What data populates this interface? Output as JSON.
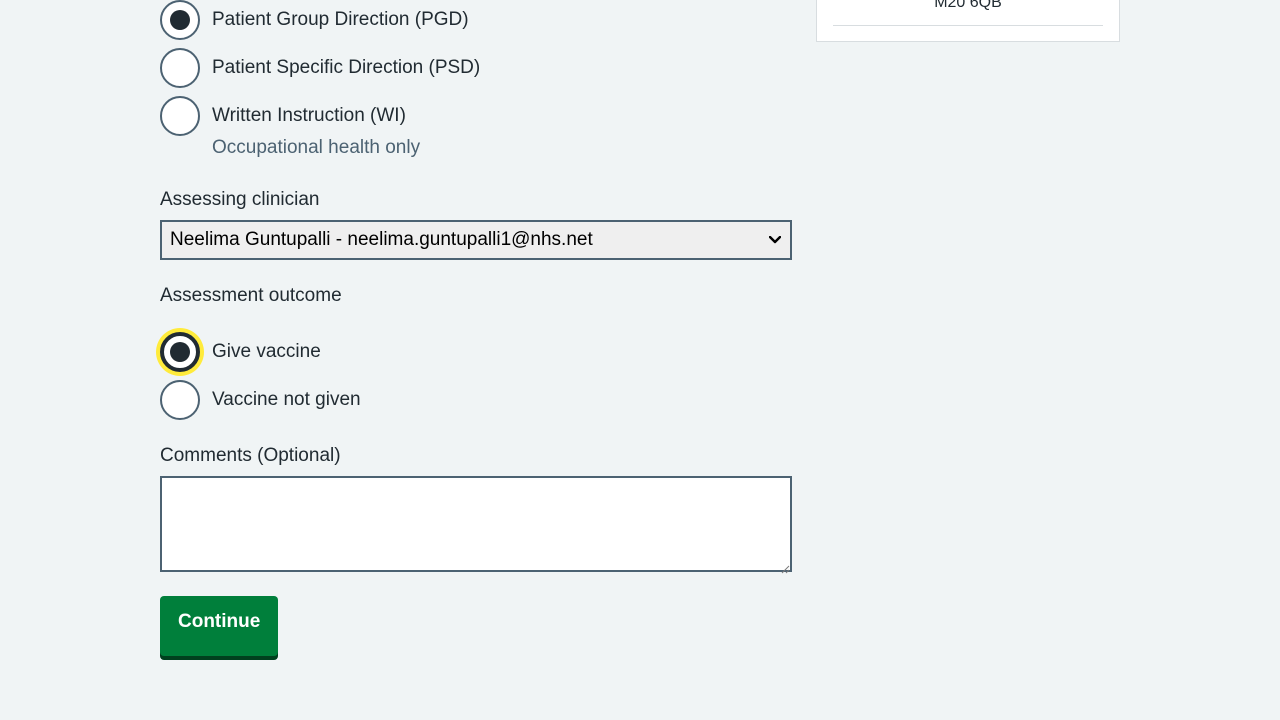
{
  "vaccination_method": {
    "options": [
      {
        "label": "Patient Group Direction (PGD)",
        "checked": true
      },
      {
        "label": "Patient Specific Direction (PSD)",
        "checked": false
      },
      {
        "label": "Written Instruction (WI)",
        "checked": false,
        "hint": "Occupational health only"
      }
    ]
  },
  "assessing_clinician": {
    "label": "Assessing clinician",
    "selected": "Neelima Guntupalli - neelima.guntupalli1@nhs.net"
  },
  "assessment_outcome": {
    "label": "Assessment outcome",
    "options": [
      {
        "label": "Give vaccine",
        "checked": true,
        "focused": true
      },
      {
        "label": "Vaccine not given",
        "checked": false
      }
    ]
  },
  "comments": {
    "label": "Comments (Optional)",
    "value": ""
  },
  "continue_button": {
    "label": "Continue"
  },
  "site_card": {
    "postcode": "M20 6QB"
  },
  "colors": {
    "background": "#f0f4f5",
    "text": "#212b32",
    "secondary_text": "#4c6272",
    "button": "#007f3b",
    "button_shadow": "#00401e",
    "focus": "#ffeb3b"
  }
}
